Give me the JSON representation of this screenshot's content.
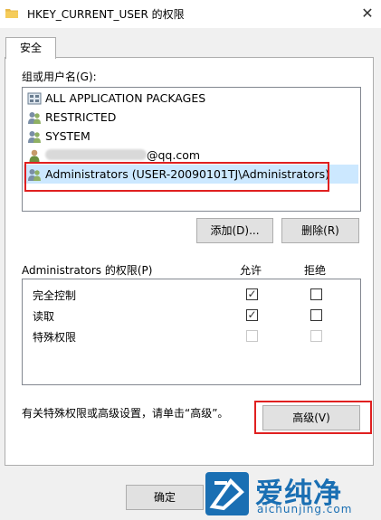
{
  "window": {
    "title": "HKEY_CURRENT_USER 的权限",
    "close_glyph": "✕"
  },
  "tabs": [
    {
      "label": "安全"
    }
  ],
  "groups": {
    "label": "组或用户名(G):",
    "items": [
      {
        "label": "ALL APPLICATION PACKAGES",
        "icon": "packages-icon"
      },
      {
        "label": "RESTRICTED",
        "icon": "users-icon"
      },
      {
        "label": "SYSTEM",
        "icon": "users-icon"
      },
      {
        "label_suffix": "@qq.com",
        "icon": "user-icon",
        "redacted": true
      },
      {
        "label": "Administrators (USER-20090101TJ\\Administrators)",
        "icon": "users-icon",
        "selected": true
      }
    ]
  },
  "buttons": {
    "add": "添加(D)...",
    "remove": "删除(R)",
    "advanced": "高级(V)",
    "ok": "确定"
  },
  "permissions": {
    "label": "Administrators 的权限(P)",
    "allow_header": "允许",
    "deny_header": "拒绝",
    "rows": [
      {
        "label": "完全控制",
        "allow": true,
        "deny": false,
        "enabled": true
      },
      {
        "label": "读取",
        "allow": true,
        "deny": false,
        "enabled": true
      },
      {
        "label": "特殊权限",
        "allow": false,
        "deny": false,
        "enabled": false
      }
    ]
  },
  "advanced_hint": "有关特殊权限或高级设置，请单击“高级”。",
  "watermark": {
    "brand_cn": "爱纯净",
    "brand_url": "aichunjing.com"
  },
  "colors": {
    "selection": "#cce8ff",
    "highlight_box": "#e02020",
    "brand_blue": "#1a6fb3"
  }
}
